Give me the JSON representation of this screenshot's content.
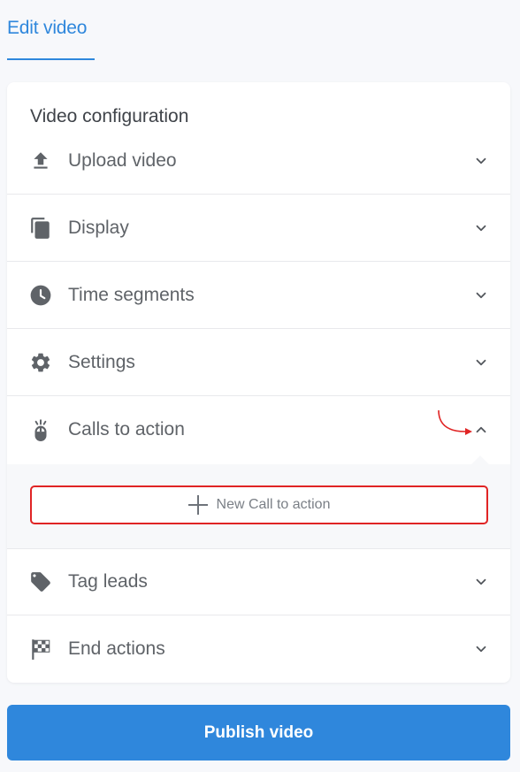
{
  "tab": {
    "label": "Edit video"
  },
  "card": {
    "title": "Video configuration"
  },
  "sections": [
    {
      "label": "Upload video",
      "icon": "upload-icon",
      "expanded": false
    },
    {
      "label": "Display",
      "icon": "copy-icon",
      "expanded": false
    },
    {
      "label": "Time segments",
      "icon": "clock-icon",
      "expanded": false
    },
    {
      "label": "Settings",
      "icon": "gear-icon",
      "expanded": false
    },
    {
      "label": "Calls to action",
      "icon": "mouse-click-icon",
      "expanded": true
    },
    {
      "label": "Tag leads",
      "icon": "tag-icon",
      "expanded": false
    },
    {
      "label": "End actions",
      "icon": "checkered-flag-icon",
      "expanded": false
    }
  ],
  "calls_to_action": {
    "new_button_label": "New Call to action"
  },
  "publish": {
    "label": "Publish video"
  },
  "colors": {
    "accent": "#2f87dc",
    "highlight": "#e02424",
    "icon": "#5f6368"
  }
}
